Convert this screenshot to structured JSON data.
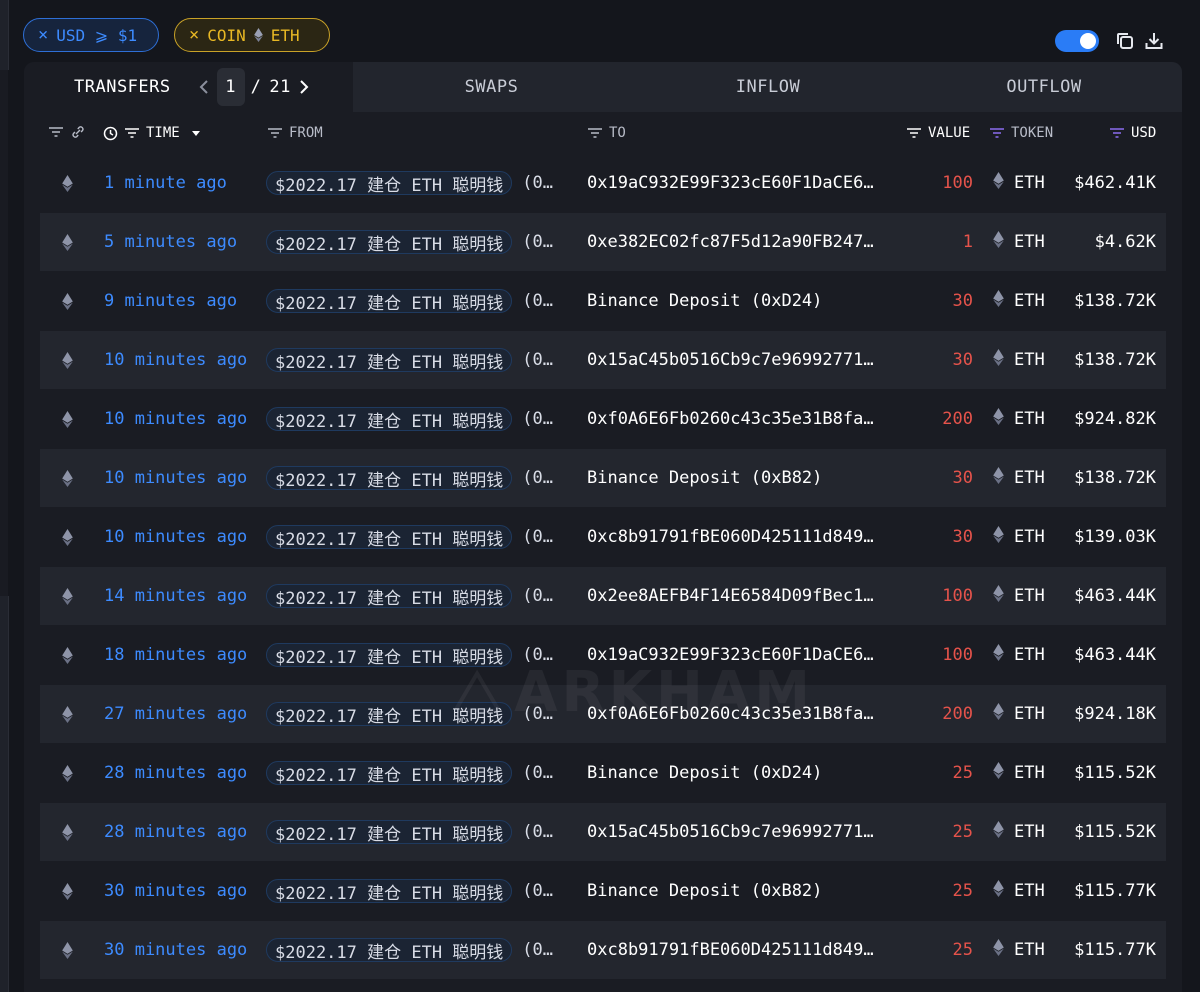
{
  "filters": {
    "usd": {
      "text": "USD ⩾ $1"
    },
    "coin": {
      "label": "COIN",
      "token": "ETH"
    },
    "remove_glyph": "×"
  },
  "controls": {
    "toggle_on": true,
    "copy_icon": "copy-icon",
    "download_icon": "download-icon"
  },
  "tabs": {
    "transfers": "TRANSFERS",
    "page_current": "1",
    "page_sep": "/",
    "page_total": "21",
    "swaps": "SWAPS",
    "inflow": "INFLOW",
    "outflow": "OUTFLOW"
  },
  "columns": {
    "time": "TIME",
    "from": "FROM",
    "to": "TO",
    "value": "VALUE",
    "token": "TOKEN",
    "usd": "USD"
  },
  "colors": {
    "accent_blue": "#3d8bff",
    "value_red": "#e5534b",
    "coin_gold": "#e8b824",
    "token_filter_purple": "#8b6cf0"
  },
  "watermark": "ARKHAM",
  "rows": [
    {
      "time": "1 minute ago",
      "from": "$2022.17 建仓 ETH 聪明钱",
      "from_trail": "(0…",
      "to": "0x19aC932E99F323cE60F1DaCE6…",
      "value": "100",
      "token": "ETH",
      "usd": "$462.41K"
    },
    {
      "time": "5 minutes ago",
      "from": "$2022.17 建仓 ETH 聪明钱",
      "from_trail": "(0…",
      "to": "0xe382EC02fc87F5d12a90FB247…",
      "value": "1",
      "token": "ETH",
      "usd": "$4.62K"
    },
    {
      "time": "9 minutes ago",
      "from": "$2022.17 建仓 ETH 聪明钱",
      "from_trail": "(0…",
      "to": "Binance Deposit (0xD24)",
      "value": "30",
      "token": "ETH",
      "usd": "$138.72K"
    },
    {
      "time": "10 minutes ago",
      "from": "$2022.17 建仓 ETH 聪明钱",
      "from_trail": "(0…",
      "to": "0x15aC45b0516Cb9c7e96992771…",
      "value": "30",
      "token": "ETH",
      "usd": "$138.72K"
    },
    {
      "time": "10 minutes ago",
      "from": "$2022.17 建仓 ETH 聪明钱",
      "from_trail": "(0…",
      "to": "0xf0A6E6Fb0260c43c35e31B8fa…",
      "value": "200",
      "token": "ETH",
      "usd": "$924.82K"
    },
    {
      "time": "10 minutes ago",
      "from": "$2022.17 建仓 ETH 聪明钱",
      "from_trail": "(0…",
      "to": "Binance Deposit (0xB82)",
      "value": "30",
      "token": "ETH",
      "usd": "$138.72K"
    },
    {
      "time": "10 minutes ago",
      "from": "$2022.17 建仓 ETH 聪明钱",
      "from_trail": "(0…",
      "to": "0xc8b91791fBE060D425111d849…",
      "value": "30",
      "token": "ETH",
      "usd": "$139.03K"
    },
    {
      "time": "14 minutes ago",
      "from": "$2022.17 建仓 ETH 聪明钱",
      "from_trail": "(0…",
      "to": "0x2ee8AEFB4F14E6584D09fBec1…",
      "value": "100",
      "token": "ETH",
      "usd": "$463.44K"
    },
    {
      "time": "18 minutes ago",
      "from": "$2022.17 建仓 ETH 聪明钱",
      "from_trail": "(0…",
      "to": "0x19aC932E99F323cE60F1DaCE6…",
      "value": "100",
      "token": "ETH",
      "usd": "$463.44K"
    },
    {
      "time": "27 minutes ago",
      "from": "$2022.17 建仓 ETH 聪明钱",
      "from_trail": "(0…",
      "to": "0xf0A6E6Fb0260c43c35e31B8fa…",
      "value": "200",
      "token": "ETH",
      "usd": "$924.18K"
    },
    {
      "time": "28 minutes ago",
      "from": "$2022.17 建仓 ETH 聪明钱",
      "from_trail": "(0…",
      "to": "Binance Deposit (0xD24)",
      "value": "25",
      "token": "ETH",
      "usd": "$115.52K"
    },
    {
      "time": "28 minutes ago",
      "from": "$2022.17 建仓 ETH 聪明钱",
      "from_trail": "(0…",
      "to": "0x15aC45b0516Cb9c7e96992771…",
      "value": "25",
      "token": "ETH",
      "usd": "$115.52K"
    },
    {
      "time": "30 minutes ago",
      "from": "$2022.17 建仓 ETH 聪明钱",
      "from_trail": "(0…",
      "to": "Binance Deposit (0xB82)",
      "value": "25",
      "token": "ETH",
      "usd": "$115.77K"
    },
    {
      "time": "30 minutes ago",
      "from": "$2022.17 建仓 ETH 聪明钱",
      "from_trail": "(0…",
      "to": "0xc8b91791fBE060D425111d849…",
      "value": "25",
      "token": "ETH",
      "usd": "$115.77K"
    }
  ]
}
